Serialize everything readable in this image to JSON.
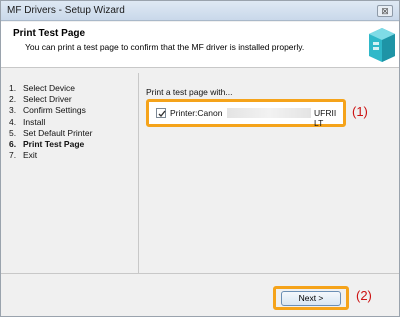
{
  "window": {
    "title": "MF Drivers - Setup Wizard",
    "close_glyph": "⊠"
  },
  "header": {
    "title": "Print Test Page",
    "description": "You can print a test page to confirm that the MF driver is installed properly."
  },
  "steps": [
    {
      "num": "1.",
      "label": "Select Device"
    },
    {
      "num": "2.",
      "label": "Select Driver"
    },
    {
      "num": "3.",
      "label": "Confirm Settings"
    },
    {
      "num": "4.",
      "label": "Install"
    },
    {
      "num": "5.",
      "label": "Set Default Printer"
    },
    {
      "num": "6.",
      "label": "Print Test Page"
    },
    {
      "num": "7.",
      "label": "Exit"
    }
  ],
  "active_step_index": 5,
  "content": {
    "prompt": "Print a test page with...",
    "printer_prefix": "Printer:Canon",
    "printer_suffix": "UFRII LT",
    "checked": true
  },
  "annotations": {
    "one": "(1)",
    "two": "(2)"
  },
  "footer": {
    "next_label": "Next >"
  },
  "colors": {
    "highlight": "#f5a31a",
    "annotation": "#cc1111"
  },
  "icons": {
    "header_icon": "printer-cube-icon",
    "checkmark": "checkmark-icon"
  }
}
